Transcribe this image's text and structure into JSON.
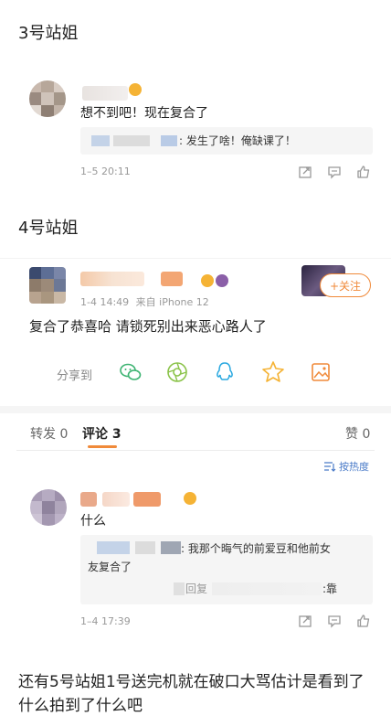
{
  "section3": {
    "heading": "3号站姐",
    "comment": "想不到吧！现在复合了",
    "reply": ":  发生了啥！俺缺课了！",
    "time": "1–5 20:11"
  },
  "section4": {
    "heading": "4号站姐",
    "post_meta_date": "1-4 14:49",
    "post_meta_source": "来自 iPhone 12",
    "follow_label": "+关注",
    "post_text": "复合了恭喜哈 请锁死别出来恶心路人了",
    "share_label": "分享到",
    "tabs": {
      "repost": "转发 0",
      "comment": "评论 3",
      "like": "赞 0"
    },
    "sort_label": "按热度",
    "comment": "什么",
    "reply_line1": ":  我那个晦气的前爱豆和他前女",
    "reply_line2": "友复合了",
    "reply_tail1": "回复",
    "reply_tail2": ":靠",
    "time": "1–4 17:39"
  },
  "footer_text": "还有5号站姐1号送完机就在破口大骂估计是看到了什么拍到了什么吧",
  "colors": {
    "accent": "#f08a3a",
    "link": "#4a7bc8",
    "reply_bg": "#f5f5f5"
  },
  "icons": [
    "repost-icon",
    "comment-icon",
    "like-icon",
    "wechat-icon",
    "moments-icon",
    "qq-icon",
    "qzone-icon",
    "save-image-icon",
    "sort-icon"
  ]
}
